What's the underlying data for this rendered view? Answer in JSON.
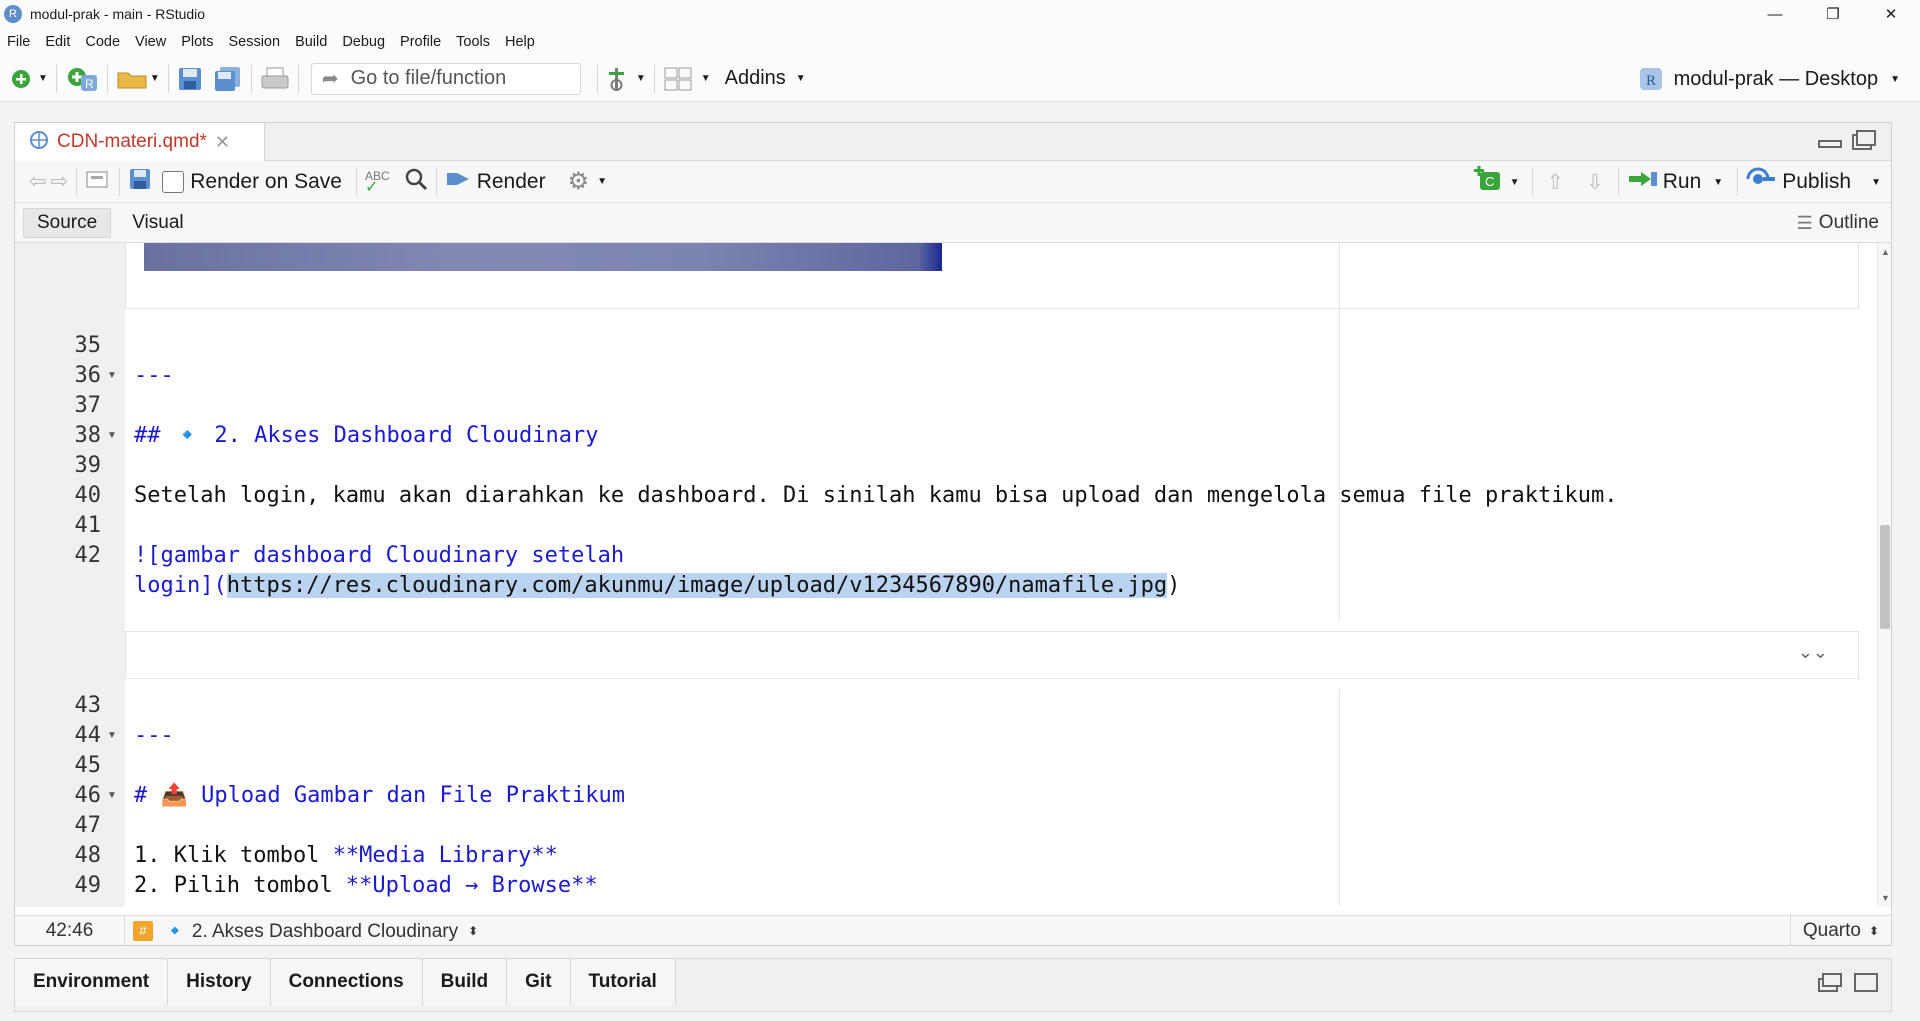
{
  "window": {
    "title": "modul-prak - main - RStudio",
    "controls": [
      "—",
      "❐",
      "✕"
    ]
  },
  "menu": [
    "File",
    "Edit",
    "Code",
    "View",
    "Plots",
    "Session",
    "Build",
    "Debug",
    "Profile",
    "Tools",
    "Help"
  ],
  "toolbar": {
    "goto_placeholder": "Go to file/function",
    "addins": "Addins",
    "project": "modul-prak — Desktop"
  },
  "editor": {
    "tab_label": "CDN-materi.qmd*",
    "render_on_save": "Render on Save",
    "render": "Render",
    "run": "Run",
    "publish": "Publish",
    "mode_source": "Source",
    "mode_visual": "Visual",
    "outline": "Outline",
    "lines": [
      {
        "n": "35",
        "text": ""
      },
      {
        "n": "36",
        "text": "---"
      },
      {
        "n": "37",
        "text": ""
      },
      {
        "n": "38",
        "text": "## 🔹 2. Akses Dashboard Cloudinary"
      },
      {
        "n": "39",
        "text": ""
      },
      {
        "n": "40",
        "text": "Setelah login, kamu akan diarahkan ke dashboard. Di sinilah kamu bisa upload dan mengelola semua file praktikum."
      },
      {
        "n": "41",
        "text": ""
      },
      {
        "n": "42",
        "text_a": "![gambar dashboard Cloudinary setelah",
        "text_b": "login](",
        "url": "https://res.cloudinary.com/akunmu/image/upload/v1234567890/namafile.jpg",
        "text_c": ")"
      },
      {
        "n": "43",
        "text": ""
      },
      {
        "n": "44",
        "text": "---"
      },
      {
        "n": "45",
        "text": ""
      },
      {
        "n": "46",
        "text": "# 📤 Upload Gambar dan File Praktikum"
      },
      {
        "n": "47",
        "text": ""
      },
      {
        "n": "48",
        "text_a": "1. Klik tombol ",
        "text_b": "**Media Library**"
      },
      {
        "n": "49",
        "text_a": "2. Pilih tombol ",
        "text_b": "**Upload → Browse**"
      }
    ],
    "status_pos": "42:46",
    "status_section": "🔹 2. Akses Dashboard Cloudinary",
    "status_mode": "Quarto"
  },
  "bottom_tabs": [
    "Environment",
    "History",
    "Connections",
    "Build",
    "Git",
    "Tutorial"
  ]
}
